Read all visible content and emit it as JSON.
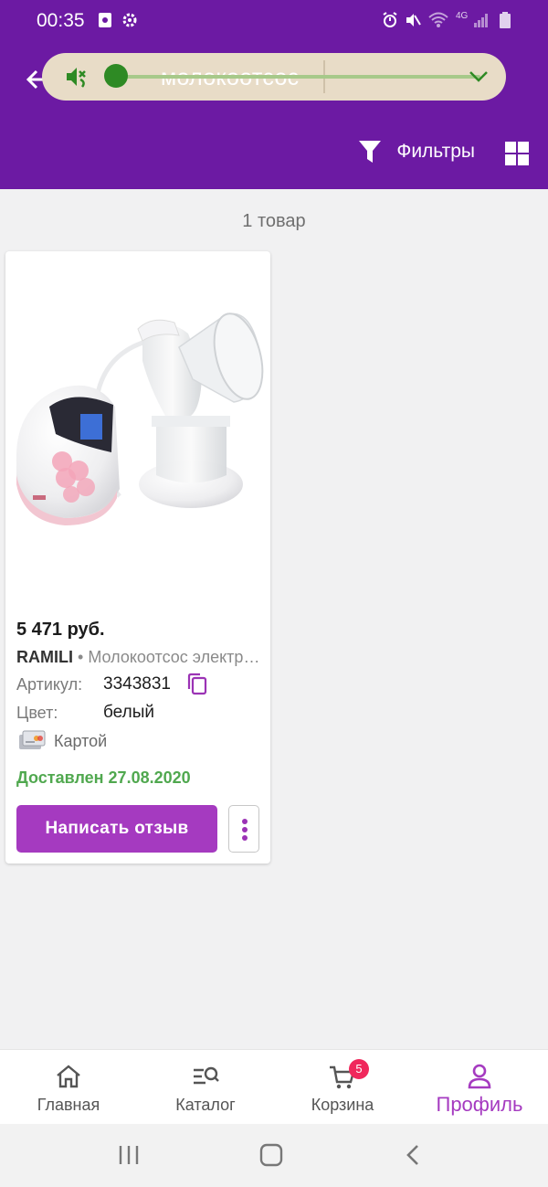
{
  "status_bar": {
    "time": "00:35",
    "network": "4G"
  },
  "search": {
    "query": "молокоотсос"
  },
  "toolbar": {
    "filters_label": "Фильтры"
  },
  "results": {
    "count_text": "1 товар"
  },
  "product": {
    "price": "5 471 руб.",
    "brand": "RAMILI",
    "separator": " • ",
    "name": "Молокоотсос электрический",
    "article_label": "Артикул:",
    "article_value": "3343831",
    "color_label": "Цвет:",
    "color_value": "белый",
    "payment_text": "Картой",
    "delivery_status": "Доставлен 27.08.2020",
    "review_button": "Написать отзыв"
  },
  "bottom_nav": {
    "items": [
      {
        "label": "Главная",
        "icon": "home-icon"
      },
      {
        "label": "Каталог",
        "icon": "catalog-search-icon"
      },
      {
        "label": "Корзина",
        "icon": "cart-icon",
        "badge": "5"
      },
      {
        "label": "Профиль",
        "icon": "profile-icon",
        "active": true
      }
    ]
  },
  "colors": {
    "header": "#6c1aa3",
    "accent": "#a53ac0",
    "delivered": "#50a84f",
    "badge": "#f0285c"
  }
}
